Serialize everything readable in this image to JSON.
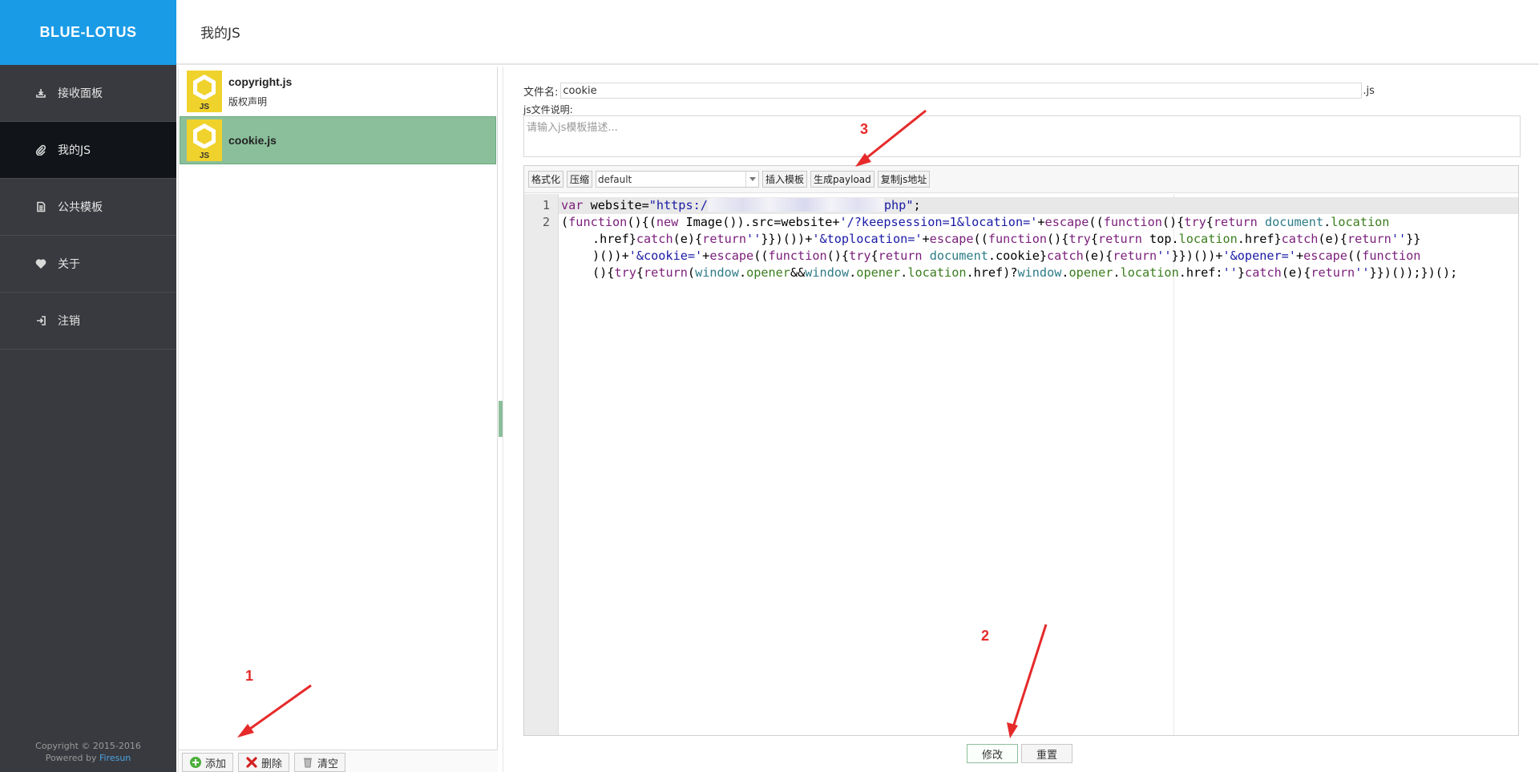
{
  "brand": "BLUE-LOTUS",
  "page_title": "我的JS",
  "sidebar": {
    "items": [
      {
        "label": "接收面板",
        "icon": "inbox-icon"
      },
      {
        "label": "我的JS",
        "icon": "paperclip-icon"
      },
      {
        "label": "公共模板",
        "icon": "document-icon"
      },
      {
        "label": "关于",
        "icon": "heart-icon"
      },
      {
        "label": "注销",
        "icon": "logout-icon"
      }
    ],
    "active_index": 1,
    "footer": {
      "copyright": "Copyright © 2015-2016",
      "powered_by": "Powered by",
      "powered_link": "Firesun"
    }
  },
  "files": [
    {
      "name": "copyright.js",
      "desc": "版权声明",
      "logo": "JS"
    },
    {
      "name": "cookie.js",
      "desc": "",
      "logo": "JS"
    }
  ],
  "file_toolbar": {
    "add": "添加",
    "delete": "删除",
    "clear": "清空"
  },
  "form": {
    "filename_label": "文件名:",
    "filename_value": "cookie",
    "filename_suffix": ".js",
    "desc_label": "js文件说明:",
    "desc_placeholder": "请输入js模板描述..."
  },
  "editor_toolbar": {
    "format": "格式化",
    "compress": "压缩",
    "theme_select": "default",
    "insert_template": "插入模板",
    "generate_payload": "生成payload",
    "copy_js_url": "复制js地址"
  },
  "code": {
    "line_numbers": [
      "1",
      "2"
    ],
    "line1_prefix": "var",
    "line1_mid": " website=",
    "line1_str_start": "\"https:/",
    "line1_str_end": "php\"",
    "line1_end": ";"
  },
  "actions": {
    "modify": "修改",
    "reset": "重置"
  },
  "annotations": [
    "1",
    "2",
    "3"
  ],
  "colors": {
    "brand_bg": "#1a9be6",
    "sidebar_bg": "#393a3f",
    "active_bg": "#111418",
    "selected_file_bg": "#8bbf9b",
    "annotation_red": "#e62a2a"
  }
}
